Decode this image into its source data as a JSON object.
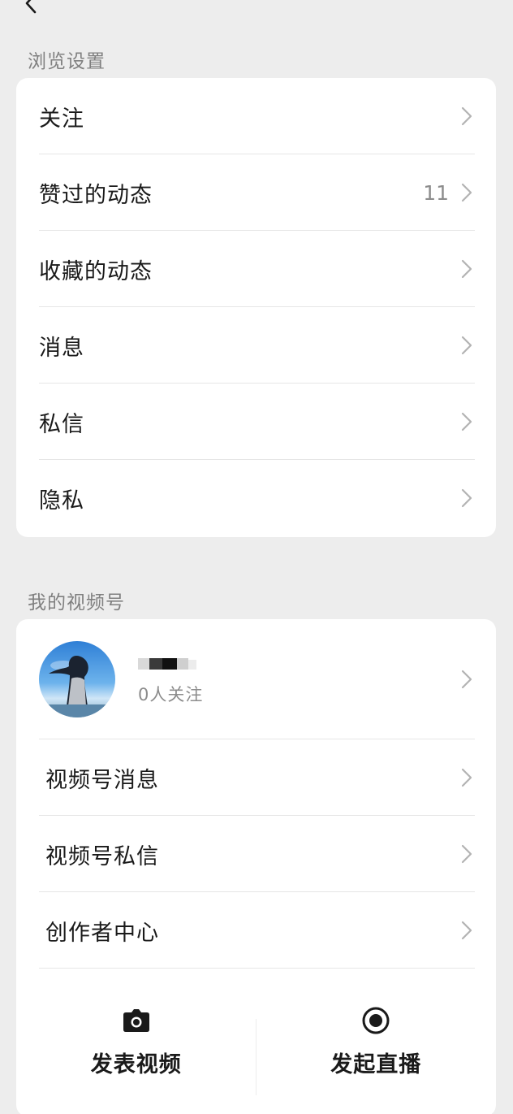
{
  "browse_section": {
    "title": "浏览设置",
    "items": [
      {
        "label": "关注",
        "count": ""
      },
      {
        "label": "赞过的动态",
        "count": "11"
      },
      {
        "label": "收藏的动态",
        "count": ""
      },
      {
        "label": "消息",
        "count": ""
      },
      {
        "label": "私信",
        "count": ""
      },
      {
        "label": "隐私",
        "count": ""
      }
    ]
  },
  "channels_section": {
    "title": "我的视频号",
    "profile": {
      "followers": "0人关注"
    },
    "items": [
      {
        "label": "视频号消息"
      },
      {
        "label": "视频号私信"
      },
      {
        "label": "创作者中心"
      }
    ],
    "actions": {
      "post_video": {
        "label": "发表视频",
        "icon": "camera-icon"
      },
      "go_live": {
        "label": "发起直播",
        "icon": "live-record-icon"
      }
    }
  },
  "icons": {
    "back": "back-chevron-icon",
    "row_arrow": "chevron-right-icon"
  },
  "colors": {
    "background": "#ededed",
    "card": "#ffffff",
    "secondary_text": "#808080"
  }
}
